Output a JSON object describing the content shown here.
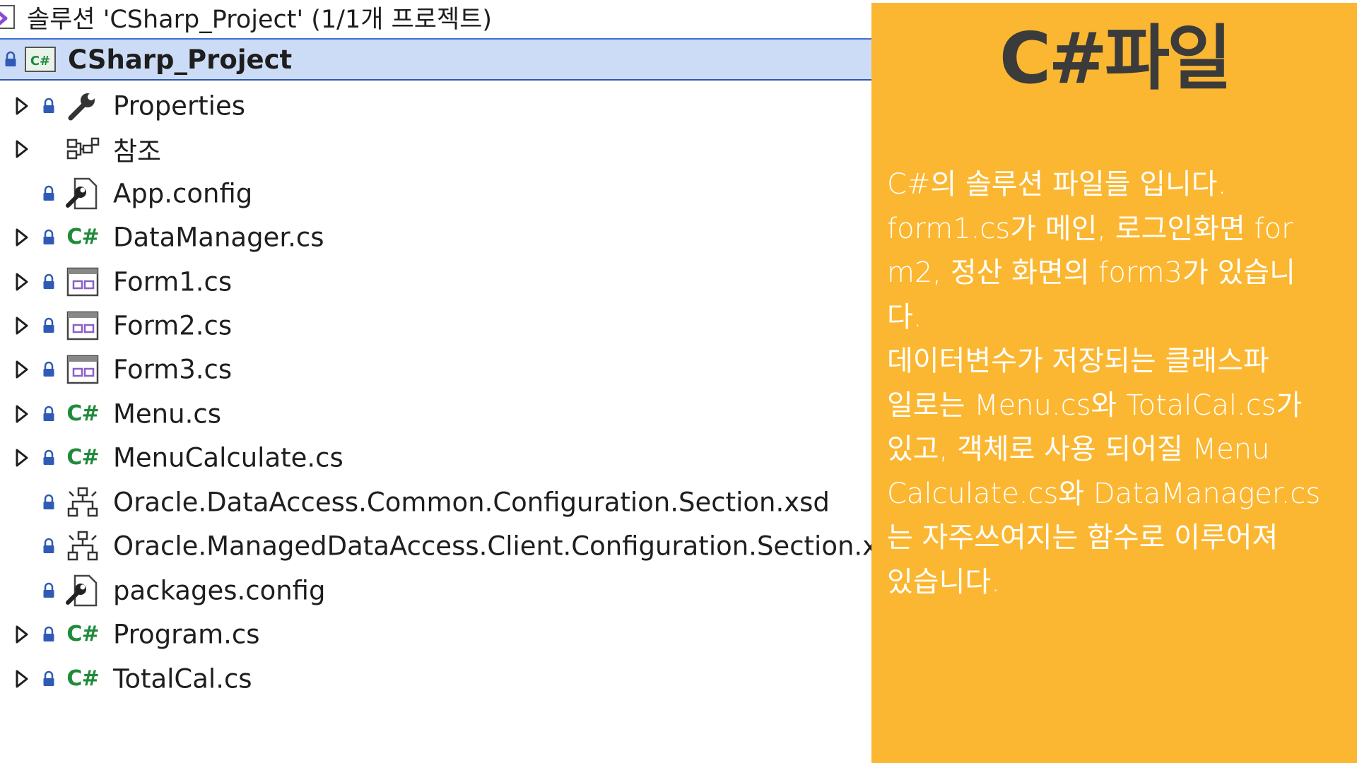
{
  "explorer": {
    "solution_title": "솔루션 'CSharp_Project' (1/1개 프로젝트)",
    "project_name": "CSharp_Project",
    "items": [
      {
        "label": "Properties",
        "icon": "wrench-icon",
        "expandable": true,
        "locked": true
      },
      {
        "label": "참조",
        "icon": "references-icon",
        "expandable": true,
        "locked": false
      },
      {
        "label": "App.config",
        "icon": "config-file-icon",
        "expandable": false,
        "locked": true
      },
      {
        "label": "DataManager.cs",
        "icon": "csharp-file-icon",
        "expandable": true,
        "locked": true
      },
      {
        "label": "Form1.cs",
        "icon": "form-file-icon",
        "expandable": true,
        "locked": true
      },
      {
        "label": "Form2.cs",
        "icon": "form-file-icon",
        "expandable": true,
        "locked": true
      },
      {
        "label": "Form3.cs",
        "icon": "form-file-icon",
        "expandable": true,
        "locked": true
      },
      {
        "label": "Menu.cs",
        "icon": "csharp-file-icon",
        "expandable": true,
        "locked": true
      },
      {
        "label": "MenuCalculate.cs",
        "icon": "csharp-file-icon",
        "expandable": true,
        "locked": true
      },
      {
        "label": "Oracle.DataAccess.Common.Configuration.Section.xsd",
        "icon": "schema-file-icon",
        "expandable": false,
        "locked": true
      },
      {
        "label": "Oracle.ManagedDataAccess.Client.Configuration.Section.xsd",
        "icon": "schema-file-icon",
        "expandable": false,
        "locked": true
      },
      {
        "label": "packages.config",
        "icon": "config-file-icon",
        "expandable": false,
        "locked": true
      },
      {
        "label": "Program.cs",
        "icon": "csharp-file-icon",
        "expandable": true,
        "locked": true
      },
      {
        "label": "TotalCal.cs",
        "icon": "csharp-file-icon",
        "expandable": true,
        "locked": true
      }
    ],
    "cs_glyph": "C#",
    "colors": {
      "selection": "#cddcf6",
      "selection_border": "#2a58b0",
      "csharp_green": "#1f8a3a",
      "form_purple": "#8b5fc7",
      "vs_purple": "#8a4bd0"
    }
  },
  "panel": {
    "title": "C#파일",
    "lines": [
      "C#의 솔루션 파일들 입니다.",
      "form1.cs가 메인, 로그인화면 for",
      "m2, 정산 화면의 form3가 있습니",
      "다.",
      "데이터변수가 저장되는 클래스파",
      "일로는 Menu.cs와 TotalCal.cs가",
      "있고,  객체로 사용 되어질 Menu",
      "Calculate.cs와 DataManager.cs",
      "는 자주쓰여지는 함수로 이루어져",
      "있습니다."
    ],
    "colors": {
      "background": "#fbb731",
      "title": "#3b3b3b",
      "text": "#ffffff"
    }
  }
}
